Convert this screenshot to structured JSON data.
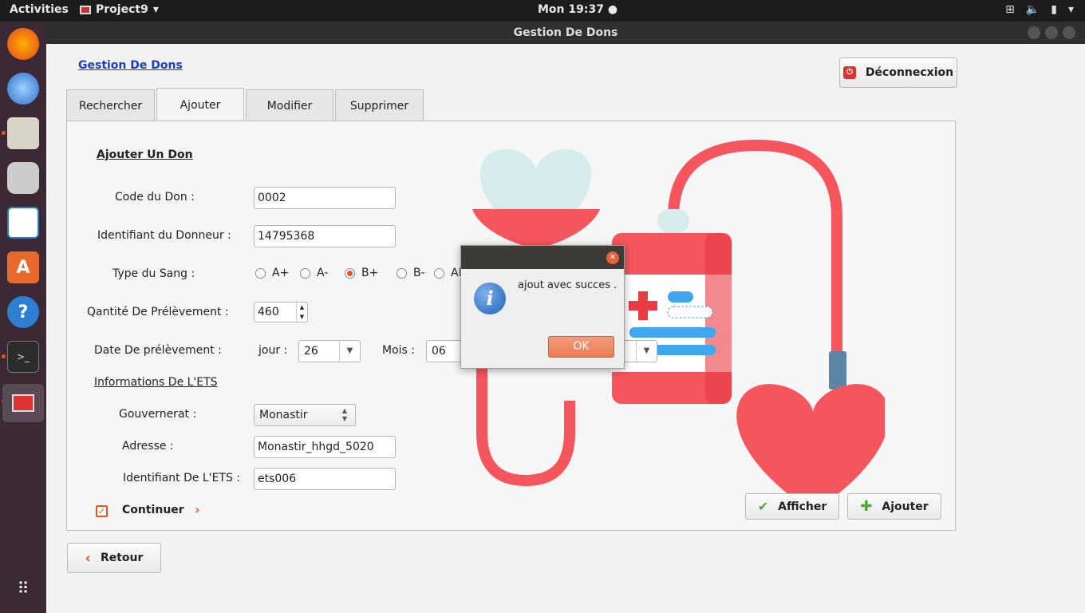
{
  "topbar": {
    "activities": "Activities",
    "app_name": "Project9",
    "clock": "Mon 19:37"
  },
  "window": {
    "title": "Gestion De Dons"
  },
  "header": {
    "link": "Gestion De Dons",
    "logout": "Déconnecxion"
  },
  "tabs": [
    {
      "label": "Rechercher"
    },
    {
      "label": "Ajouter"
    },
    {
      "label": "Modifier"
    },
    {
      "label": "Supprimer"
    }
  ],
  "form": {
    "section_title": "Ajouter Un Don",
    "code_label": "Code du Don :",
    "code_value": "0002",
    "donor_label": "Identifiant du Donneur :",
    "donor_value": "14795368",
    "blood_label": "Type du Sang :",
    "blood_options": [
      "A+",
      "A-",
      "B+",
      "B-",
      "AB+"
    ],
    "blood_selected": "B+",
    "qty_label": "Qantité De Prélèvement :",
    "qty_value": "460",
    "date_label": "Date De prélèvement :",
    "day_label": "jour :",
    "day_value": "26",
    "month_label": "Mois :",
    "month_value": "06",
    "ets_section": "Informations  De L'ETS",
    "gov_label": "Gouvernerat :",
    "gov_value": "Monastir",
    "addr_label": "Adresse :",
    "addr_value": "Monastir_hhgd_5020",
    "ets_label": "Identifiant De L'ETS :",
    "ets_value": "ets006",
    "continue_label": "Continuer"
  },
  "buttons": {
    "show": "Afficher",
    "add": "Ajouter",
    "back": "Retour"
  },
  "dialog": {
    "message": "ajout avec succes .",
    "ok": "OK"
  },
  "colors": {
    "accent": "#e95420",
    "heart": "#f5555d",
    "link": "#1a3fc4"
  }
}
